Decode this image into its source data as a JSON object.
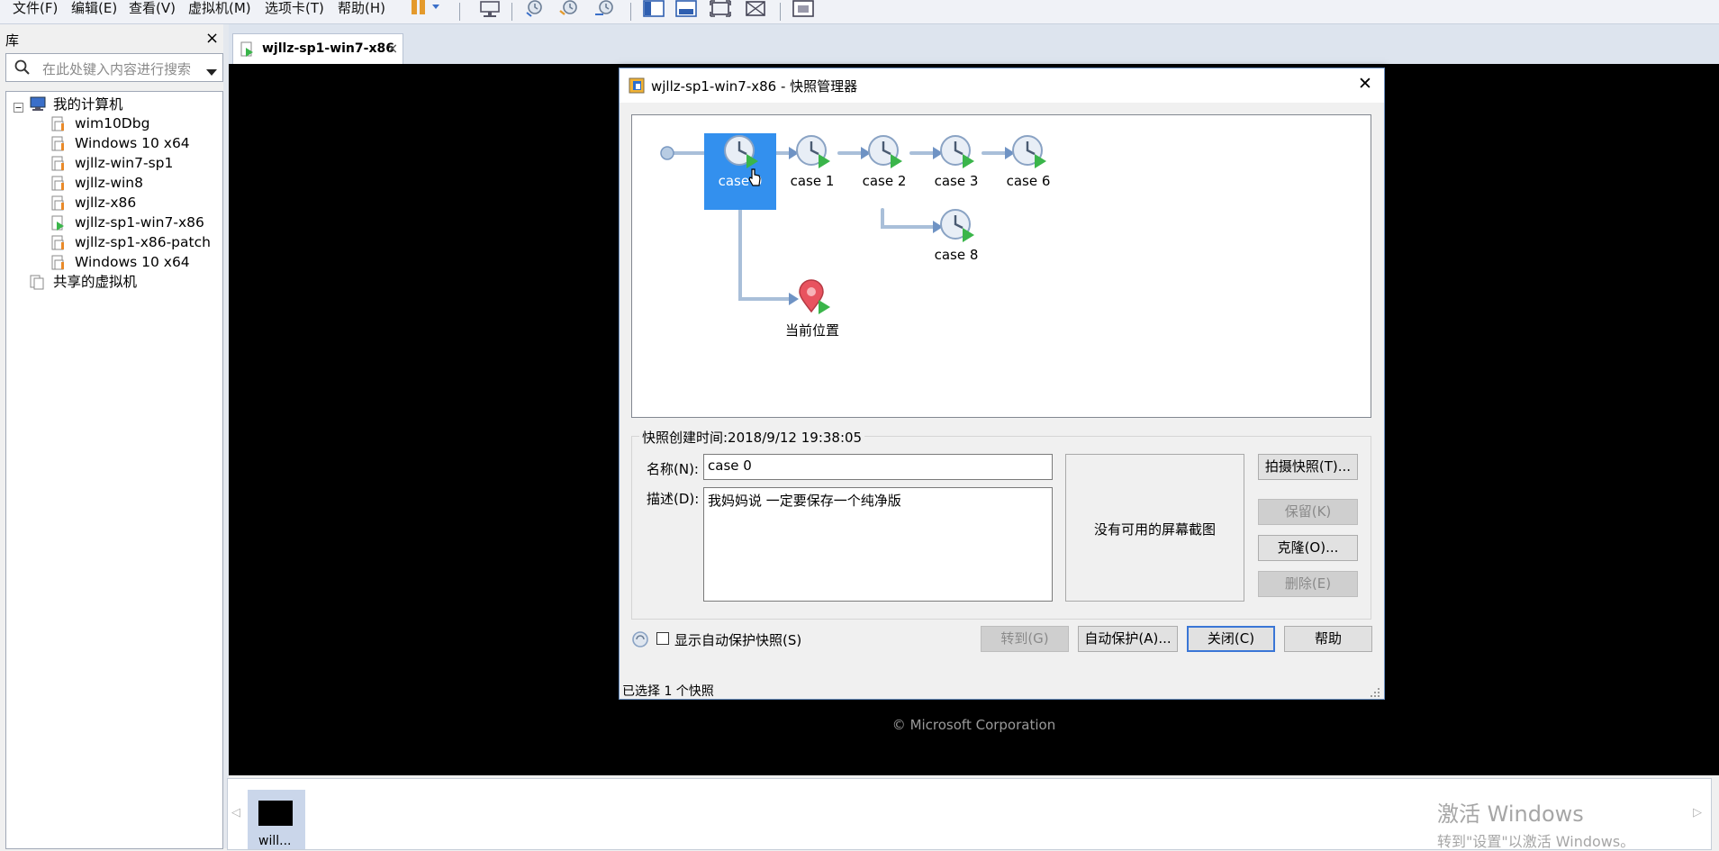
{
  "menubar": {
    "items": [
      "文件(F)",
      "编辑(E)",
      "查看(V)",
      "虚拟机(M)",
      "选项卡(T)",
      "帮助(H)"
    ]
  },
  "library": {
    "title": "库",
    "close": "×",
    "search_placeholder": "在此处键入内容进行搜索",
    "root_label": "我的计算机",
    "vms": [
      "wim10Dbg",
      "Windows 10 x64",
      "wjllz-win7-sp1",
      "wjllz-win8",
      "wjllz-x86",
      "wjllz-sp1-win7-x86",
      "wjllz-sp1-x86-patch",
      "Windows 10 x64"
    ],
    "shared_label": "共享的虚拟机"
  },
  "tabs": [
    {
      "label": "wjllz-sp1-win7-x86",
      "close": "×"
    }
  ],
  "vm_screen": {
    "copyright": "© Microsoft Corporation"
  },
  "thumbnails": [
    {
      "label": "will..."
    }
  ],
  "watermark": {
    "line1": "激活 Windows",
    "line2": "转到\"设置\"以激活 Windows。"
  },
  "dialog": {
    "title": "wjllz-sp1-win7-x86 - 快照管理器",
    "close": "✕",
    "snapshots": {
      "case0": "case 0",
      "case1": "case 1",
      "case2": "case 2",
      "case3": "case 3",
      "case6": "case 6",
      "case8": "case 8",
      "current": "当前位置"
    },
    "selected_snapshot": "case 0",
    "created_time": "快照创建时间:2018/9/12 19:38:05",
    "name_label": "名称(N):",
    "name_value": "case 0",
    "desc_label": "描述(D):",
    "desc_value": "我妈妈说 一定要保存一个纯净版",
    "no_screenshot": "没有可用的屏幕截图",
    "buttons": {
      "take": "拍摄快照(T)...",
      "keep": "保留(K)",
      "clone": "克隆(O)...",
      "delete": "删除(E)",
      "goto": "转到(G)",
      "autoprotect": "自动保护(A)...",
      "close": "关闭(C)",
      "help": "帮助"
    },
    "show_autoprotect_label": "显示自动保护快照(S)",
    "show_autoprotect_checked": false,
    "status": "已选择 1 个快照"
  },
  "colors": {
    "selection": "#3390ee",
    "dialog_border": "#6b8fbf",
    "default_button_border": "#3a76d6",
    "play_green": "#3ab54a",
    "current_pin": "#e8535f"
  }
}
